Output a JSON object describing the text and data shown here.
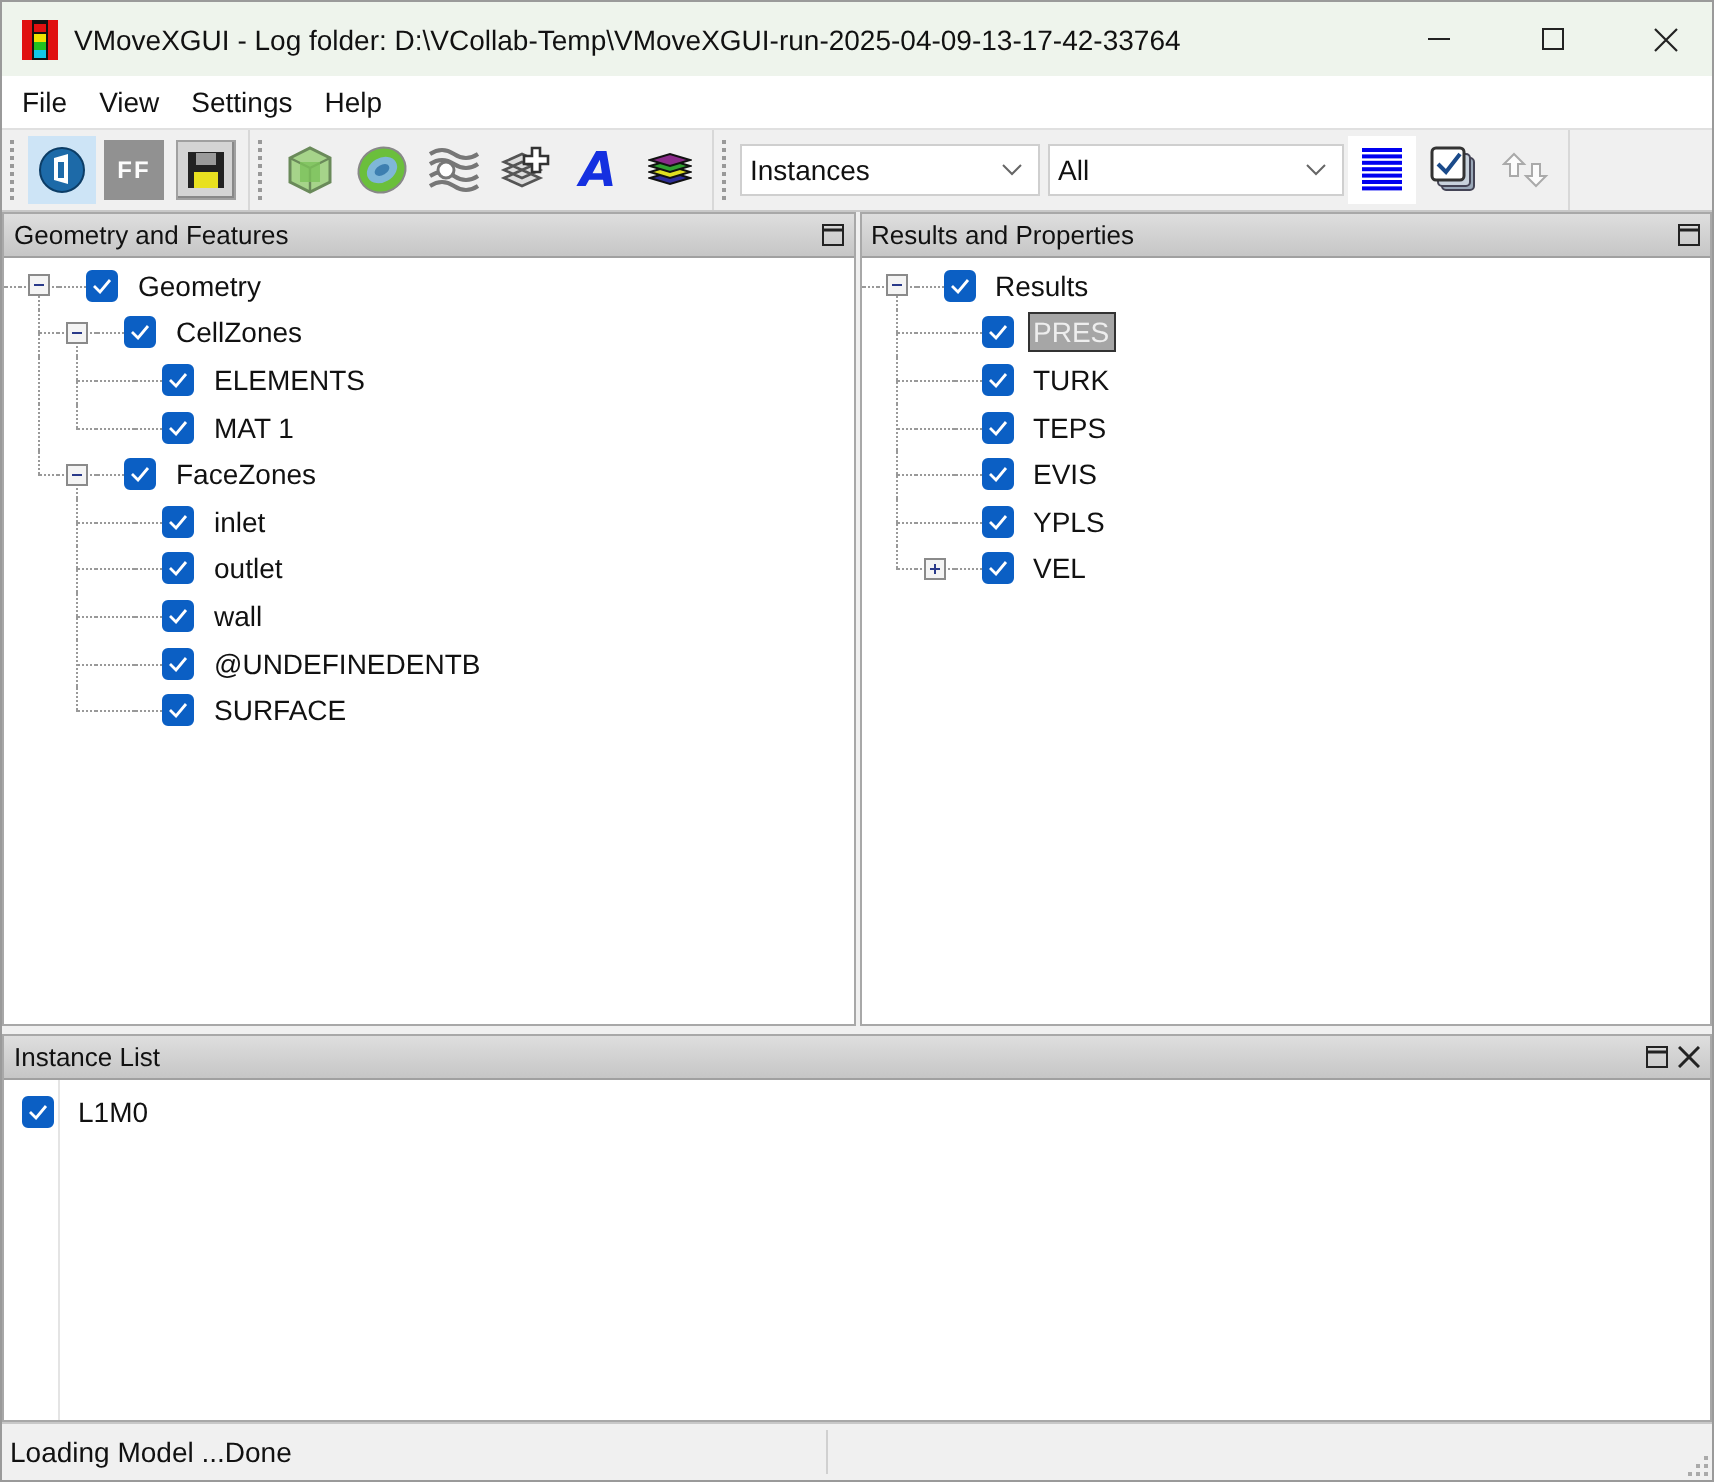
{
  "window": {
    "title": "VMoveXGUI - Log folder: D:\\VCollab-Temp\\VMoveXGUI-run-2025-04-09-13-17-42-33764"
  },
  "menu": [
    "File",
    "View",
    "Settings",
    "Help"
  ],
  "toolbars": [
    {
      "items": [
        {
          "kind": "open",
          "on": true,
          "disabled": false
        },
        {
          "kind": "ff",
          "label": "FF",
          "on": false,
          "disabled": true
        },
        {
          "kind": "save",
          "on": false,
          "disabled": false
        }
      ]
    },
    {
      "items": [
        {
          "kind": "cube",
          "on": false,
          "disabled": false
        },
        {
          "kind": "disc",
          "on": false,
          "disabled": false
        },
        {
          "kind": "waves",
          "on": false,
          "disabled": false
        },
        {
          "kind": "layers-plus",
          "on": false,
          "disabled": false
        },
        {
          "kind": "text",
          "label": "A",
          "on": false,
          "disabled": false
        },
        {
          "kind": "layers",
          "on": false,
          "disabled": false
        }
      ]
    },
    {
      "items": [
        {
          "kind": "dropdown",
          "value": "Instances"
        },
        {
          "kind": "dropdown",
          "value": "All"
        },
        {
          "kind": "lines",
          "on": true,
          "disabled": false
        },
        {
          "kind": "checklist",
          "on": false,
          "disabled": false
        },
        {
          "kind": "swap",
          "on": false,
          "disabled": true
        }
      ]
    }
  ],
  "geometry_panel": {
    "title": "Geometry and Features",
    "tree": [
      {
        "label": "Geometry",
        "checked": true,
        "selected": false,
        "expanded": true,
        "children": [
          {
            "label": "CellZones",
            "checked": true,
            "selected": false,
            "expanded": true,
            "children": [
              {
                "label": "ELEMENTS",
                "checked": true,
                "selected": false
              },
              {
                "label": "MAT 1",
                "checked": true,
                "selected": false
              }
            ]
          },
          {
            "label": "FaceZones",
            "checked": true,
            "selected": false,
            "expanded": true,
            "children": [
              {
                "label": "inlet",
                "checked": true,
                "selected": false
              },
              {
                "label": "outlet",
                "checked": true,
                "selected": false
              },
              {
                "label": "wall",
                "checked": true,
                "selected": false
              },
              {
                "label": "@UNDEFINEDENTB",
                "checked": true,
                "selected": false
              },
              {
                "label": "SURFACE",
                "checked": true,
                "selected": false
              }
            ]
          }
        ]
      }
    ]
  },
  "results_panel": {
    "title": "Results and Properties",
    "tree": [
      {
        "label": "Results",
        "checked": true,
        "selected": false,
        "expanded": true,
        "children": [
          {
            "label": "PRES",
            "checked": true,
            "selected": true
          },
          {
            "label": "TURK",
            "checked": true,
            "selected": false
          },
          {
            "label": "TEPS",
            "checked": true,
            "selected": false
          },
          {
            "label": "EVIS",
            "checked": true,
            "selected": false
          },
          {
            "label": "YPLS",
            "checked": true,
            "selected": false
          },
          {
            "label": "VEL",
            "checked": true,
            "selected": false,
            "expanded": false
          }
        ]
      }
    ]
  },
  "instance_list": {
    "title": "Instance List",
    "items": [
      {
        "label": "L1M0",
        "checked": true
      }
    ]
  },
  "status_bar": {
    "message": "Loading Model ...Done"
  }
}
